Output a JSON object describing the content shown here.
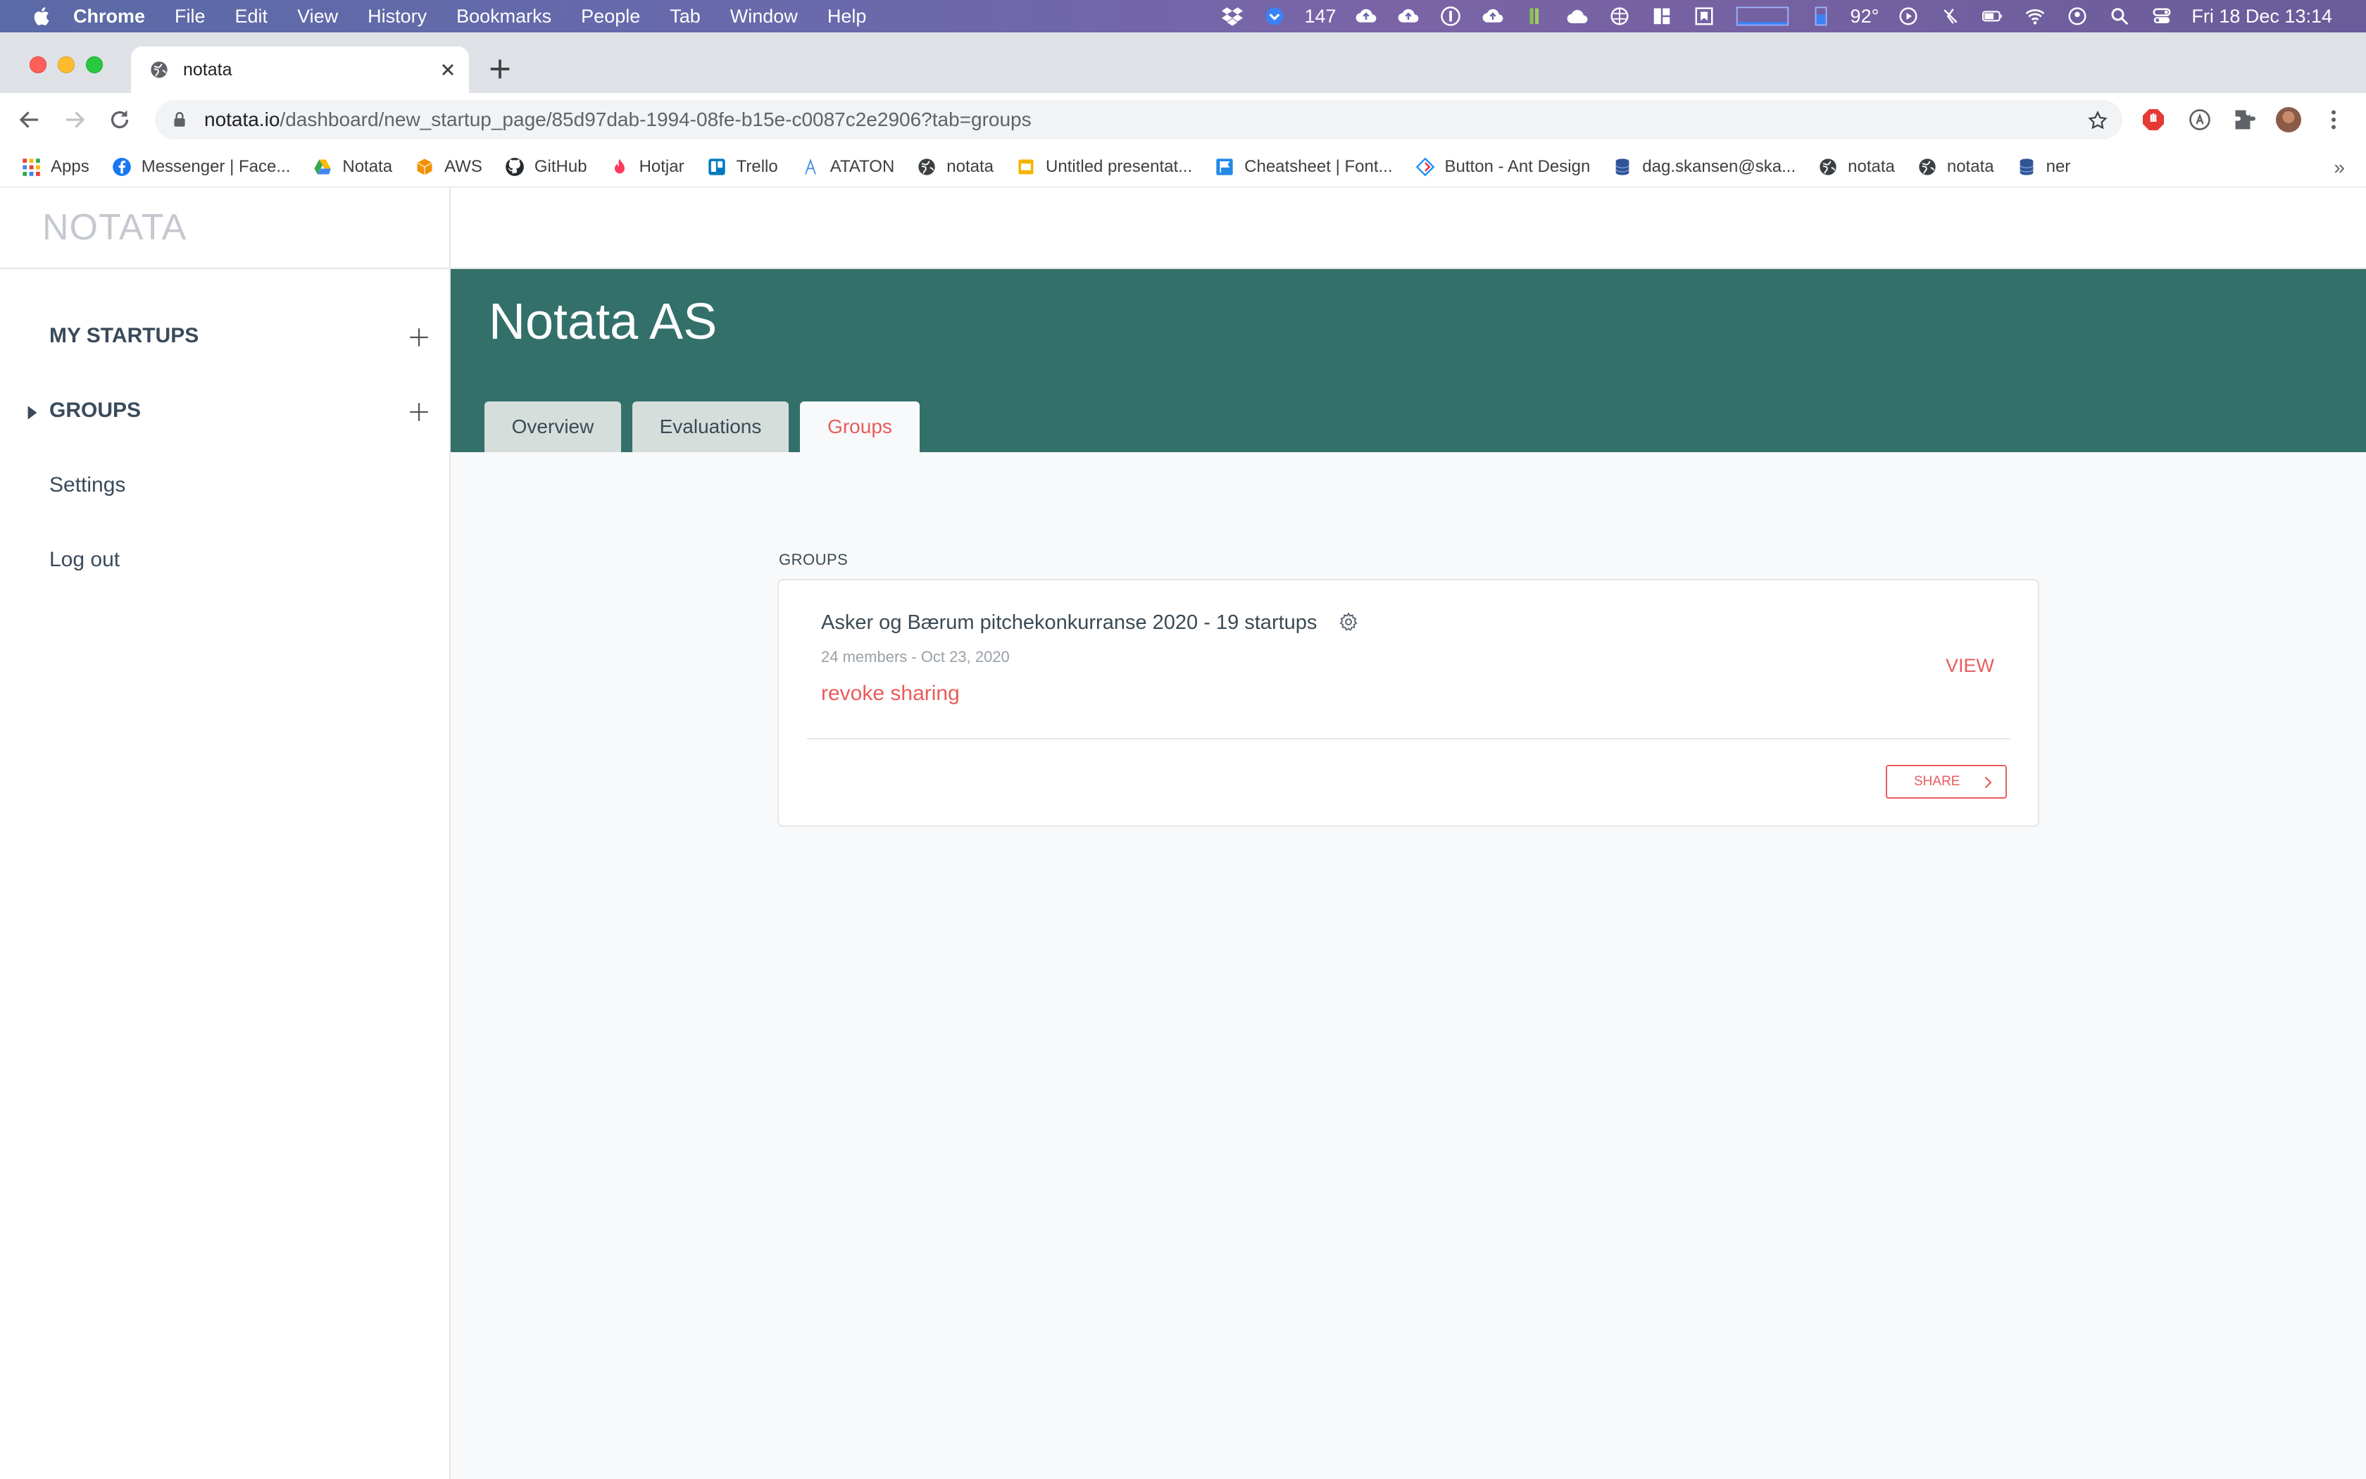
{
  "menubar": {
    "app_name": "Chrome",
    "items": [
      "File",
      "Edit",
      "View",
      "History",
      "Bookmarks",
      "People",
      "Tab",
      "Window",
      "Help"
    ],
    "badge_count": "147",
    "temperature": "92°",
    "datetime": "Fri 18 Dec  13:14"
  },
  "browser": {
    "tab_title": "notata",
    "url_host": "notata.io",
    "url_path": "/dashboard/new_startup_page/85d97dab-1994-08fe-b15e-c0087c2e2906?tab=groups"
  },
  "bookmarks": [
    {
      "label": "Apps",
      "icon": "apps-grid-icon",
      "color": "#4285f4"
    },
    {
      "label": "Messenger | Face...",
      "icon": "facebook-icon",
      "color": "#1877f2"
    },
    {
      "label": "Notata",
      "icon": "drive-icon",
      "color": "#34a853"
    },
    {
      "label": "AWS",
      "icon": "aws-cube-icon",
      "color": "#f29100"
    },
    {
      "label": "GitHub",
      "icon": "github-icon",
      "color": "#24292e"
    },
    {
      "label": "Hotjar",
      "icon": "hotjar-flame-icon",
      "color": "#fd3a5c"
    },
    {
      "label": "Trello",
      "icon": "trello-icon",
      "color": "#0079bf"
    },
    {
      "label": "ATATON",
      "icon": "ataton-icon",
      "color": "#4a90e2"
    },
    {
      "label": "notata",
      "icon": "globe-icon",
      "color": "#3c4043"
    },
    {
      "label": "Untitled presentat...",
      "icon": "slides-icon",
      "color": "#f4b400"
    },
    {
      "label": "Cheatsheet | Font...",
      "icon": "flag-icon",
      "color": "#228ae6"
    },
    {
      "label": "Button - Ant Design",
      "icon": "ant-design-icon",
      "color": "#1890ff"
    },
    {
      "label": "dag.skansen@ska...",
      "icon": "database-icon",
      "color": "#2f5597"
    },
    {
      "label": "notata",
      "icon": "globe-icon",
      "color": "#3c4043"
    },
    {
      "label": "notata",
      "icon": "globe-icon",
      "color": "#3c4043"
    },
    {
      "label": "ner",
      "icon": "database-icon",
      "color": "#2f5597"
    }
  ],
  "bookmarks_more": "»",
  "app": {
    "logo": "NOTATA",
    "sidebar": {
      "my_startups": "MY STARTUPS",
      "groups": "GROUPS",
      "settings": "Settings",
      "logout": "Log out"
    },
    "company_name": "Notata AS",
    "tabs": [
      {
        "label": "Overview",
        "active": false
      },
      {
        "label": "Evaluations",
        "active": false
      },
      {
        "label": "Groups",
        "active": true
      }
    ],
    "groups_heading": "GROUPS",
    "group": {
      "title": "Asker og Bærum pitchekonkurranse 2020 - 19 startups",
      "meta": "24 members - Oct 23, 2020",
      "revoke_label": "revoke sharing",
      "view_label": "VIEW",
      "share_label": "SHARE"
    },
    "colors": {
      "banner": "#33706a",
      "accent": "#e85c5c",
      "background": "#f8f9fa"
    }
  }
}
